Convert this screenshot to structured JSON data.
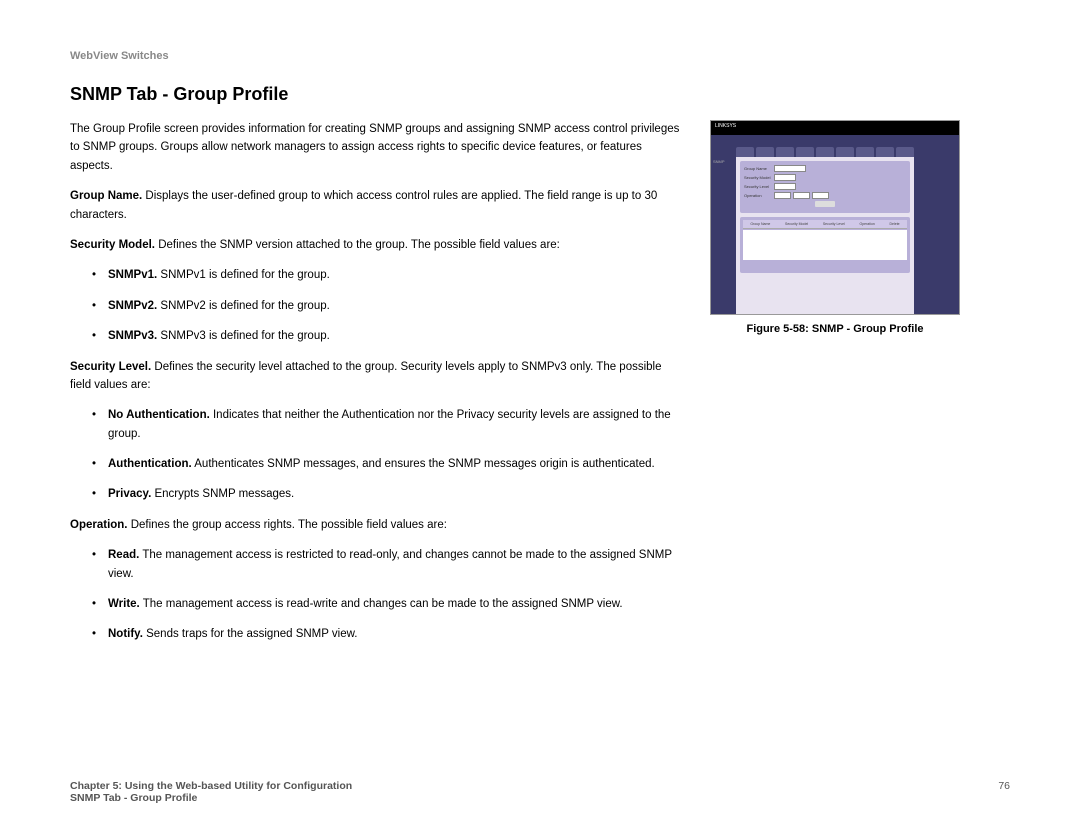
{
  "header": "WebView Switches",
  "title": "SNMP Tab - Group Profile",
  "intro": "The Group Profile screen provides information for creating SNMP groups and assigning SNMP access control privileges to SNMP groups. Groups allow network managers to assign access rights to specific device features, or features aspects.",
  "fields": {
    "groupName": {
      "label": "Group Name.",
      "desc": " Displays the user-defined group to which access control rules are applied. The field range is up to 30 characters."
    },
    "securityModel": {
      "label": "Security Model.",
      "desc": " Defines the SNMP version attached to the group. The possible field values are:"
    },
    "snmpv1": {
      "label": "SNMPv1.",
      "desc": " SNMPv1 is defined for the group."
    },
    "snmpv2": {
      "label": "SNMPv2.",
      "desc": " SNMPv2 is defined for the group."
    },
    "snmpv3": {
      "label": "SNMPv3.",
      "desc": " SNMPv3 is defined for the group."
    },
    "securityLevel": {
      "label": "Security Level.",
      "desc": " Defines the security level attached to the group. Security levels apply to SNMPv3 only. The possible field values are:"
    },
    "noAuth": {
      "label": "No Authentication.",
      "desc": " Indicates that neither the Authentication nor the Privacy security levels are assigned to the group."
    },
    "auth": {
      "label": "Authentication.",
      "desc": " Authenticates SNMP messages, and ensures the SNMP messages origin is authenticated."
    },
    "privacy": {
      "label": "Privacy.",
      "desc": " Encrypts SNMP messages."
    },
    "operation": {
      "label": "Operation.",
      "desc": " Defines the group access rights. The possible field values are:"
    },
    "read": {
      "label": "Read.",
      "desc": " The management access is restricted to read-only, and changes cannot be made to the assigned SNMP view."
    },
    "write": {
      "label": "Write.",
      "desc": " The management access is read-write and changes can be made to the assigned SNMP view."
    },
    "notify": {
      "label": "Notify.",
      "desc": " Sends traps for the assigned SNMP view."
    }
  },
  "figure": {
    "caption": "Figure 5-58: SNMP - Group Profile",
    "brand": "LINKSYS"
  },
  "footer": {
    "chapter": "Chapter 5: Using the Web-based Utility for Configuration",
    "section": "SNMP Tab - Group Profile",
    "page": "76"
  }
}
